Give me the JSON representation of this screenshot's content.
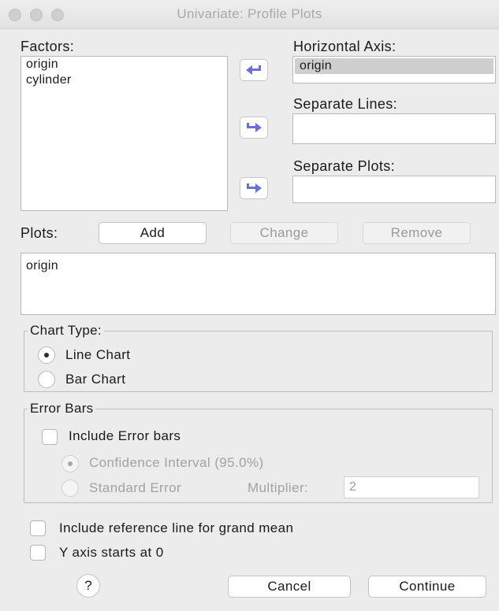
{
  "window": {
    "title": "Univariate: Profile Plots"
  },
  "factors": {
    "label": "Factors:",
    "items": [
      "origin",
      "cylinder"
    ]
  },
  "horizontal_axis": {
    "label": "Horizontal Axis:",
    "value": "origin"
  },
  "separate_lines": {
    "label": "Separate Lines:"
  },
  "separate_plots": {
    "label": "Separate Plots:"
  },
  "plots": {
    "label": "Plots:",
    "add_label": "Add",
    "change_label": "Change",
    "remove_label": "Remove",
    "items": [
      "origin"
    ]
  },
  "chart_type": {
    "legend": "Chart Type:",
    "options": [
      {
        "label": "Line Chart",
        "selected": true
      },
      {
        "label": "Bar Chart",
        "selected": false
      }
    ]
  },
  "error_bars": {
    "legend": "Error Bars",
    "include_label": "Include Error bars",
    "include_checked": false,
    "ci_label": "Confidence Interval (95.0%)",
    "se_label": "Standard Error",
    "multiplier_label": "Multiplier:",
    "multiplier_value": "2"
  },
  "options": {
    "grand_mean_label": "Include reference line for grand mean",
    "y_axis_zero_label": "Y axis starts at 0"
  },
  "footer": {
    "help_label": "?",
    "cancel_label": "Cancel",
    "continue_label": "Continue"
  },
  "colors": {
    "arrow": "#6b6fd8"
  }
}
